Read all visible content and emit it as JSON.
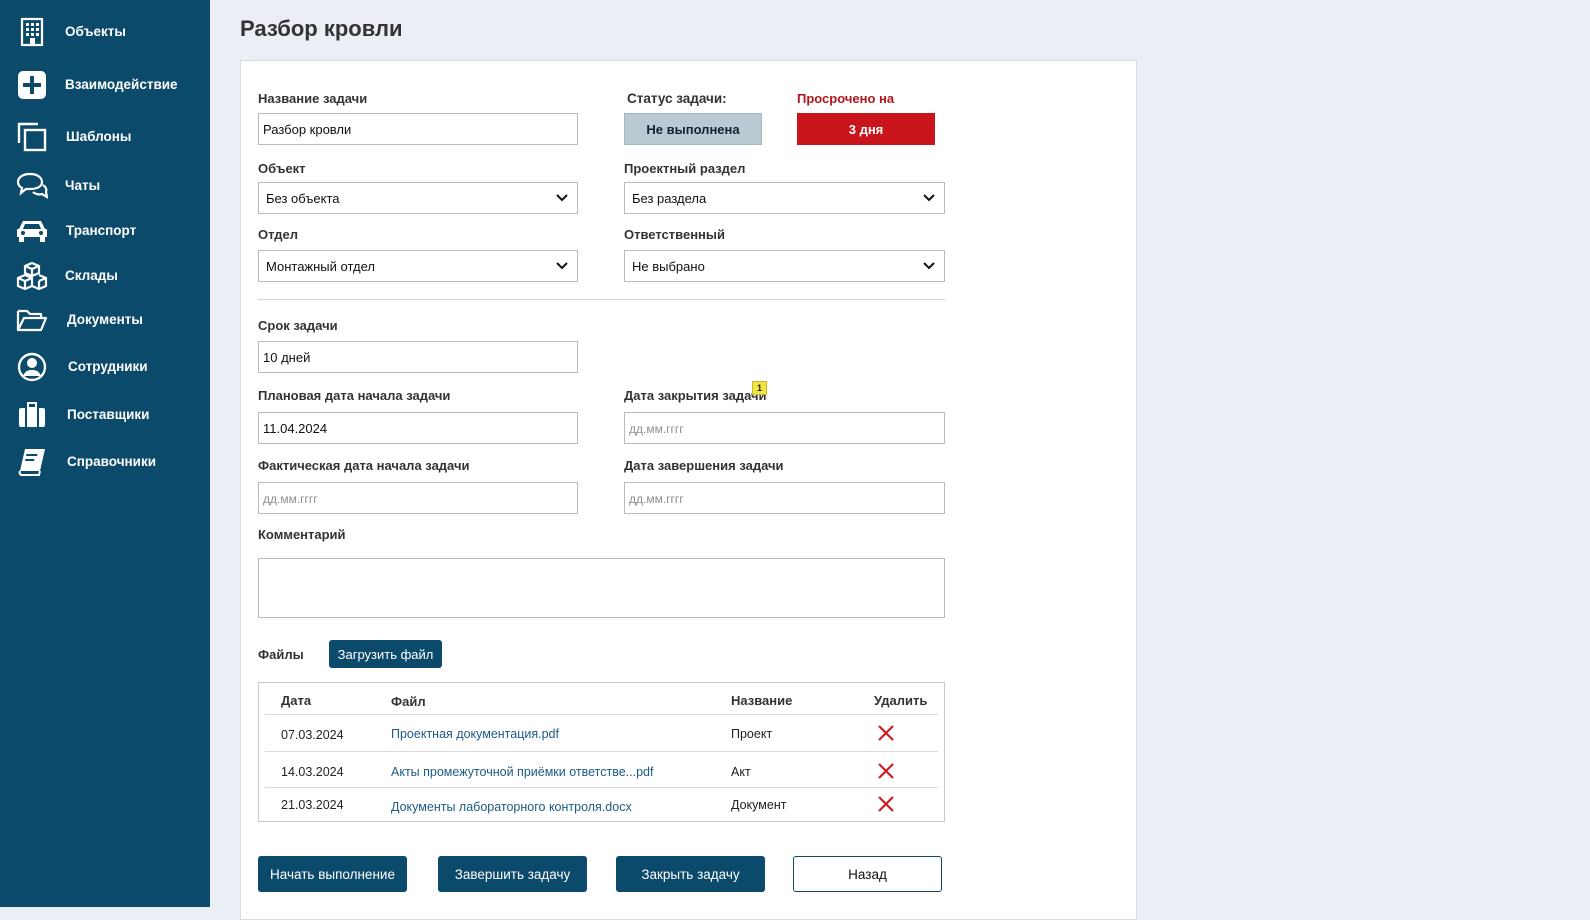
{
  "sidebar": {
    "items": [
      {
        "label": "Объекты",
        "icon": "building-icon"
      },
      {
        "label": "Взаимодействие",
        "icon": "plus-square-icon"
      },
      {
        "label": "Шаблоны",
        "icon": "copy-icon"
      },
      {
        "label": "Чаты",
        "icon": "chat-bubbles-icon"
      },
      {
        "label": "Транспорт",
        "icon": "car-icon"
      },
      {
        "label": "Склады",
        "icon": "boxes-icon"
      },
      {
        "label": "Документы",
        "icon": "folder-icon"
      },
      {
        "label": "Сотрудники",
        "icon": "user-circle-icon"
      },
      {
        "label": "Поставщики",
        "icon": "briefcase-icon"
      },
      {
        "label": "Справочники",
        "icon": "book-icon"
      }
    ]
  },
  "page": {
    "title": "Разбор кровли"
  },
  "form": {
    "task_name": {
      "label": "Название задачи",
      "value": "Разбор кровли"
    },
    "status": {
      "label": "Статус задачи:",
      "value": "Не выполнена"
    },
    "overdue": {
      "label": "Просрочено на",
      "value": "3 дня"
    },
    "object": {
      "label": "Объект",
      "value": "Без объекта"
    },
    "project_section": {
      "label": "Проектный раздел",
      "value": "Без раздела"
    },
    "department": {
      "label": "Отдел",
      "value": "Монтажный отдел"
    },
    "responsible": {
      "label": "Ответственный",
      "value": "Не выбрано"
    },
    "deadline": {
      "label": "Срок задачи",
      "value": "10 дней"
    },
    "planned_start": {
      "label": "Плановая дата начала задачи",
      "value": "11.04.2024"
    },
    "close_date": {
      "label": "Дата закрытия задачи",
      "placeholder": "дд.мм.гггг",
      "badge": "1"
    },
    "actual_start": {
      "label": "Фактическая дата начала задачи",
      "placeholder": "дд.мм.гггг"
    },
    "finish_date": {
      "label": "Дата завершения задачи",
      "placeholder": "дд.мм.гггг"
    },
    "comment": {
      "label": "Комментарий",
      "value": ""
    }
  },
  "files": {
    "label": "Файлы",
    "upload_button": "Загрузить файл",
    "columns": {
      "date": "Дата",
      "file": "Файл",
      "name": "Название",
      "delete": "Удалить"
    },
    "rows": [
      {
        "date": "07.03.2024",
        "file": "Проектная документация.pdf",
        "name": "Проект"
      },
      {
        "date": "14.03.2024",
        "file": "Акты промежуточной приёмки ответстве...pdf",
        "name": "Акт"
      },
      {
        "date": "21.03.2024",
        "file": "Документы лабораторного контроля.docx",
        "name": "Документ"
      }
    ]
  },
  "actions": {
    "start": "Начать выполнение",
    "complete": "Завершить задачу",
    "close": "Закрыть задачу",
    "back": "Назад"
  },
  "colors": {
    "sidebar": "#0c4a6b",
    "primary_button": "#0c4a6b",
    "overdue": "#c9141b",
    "status_chip": "#b9cad3",
    "delete_icon": "#d11a22",
    "link": "#1c5b86"
  }
}
